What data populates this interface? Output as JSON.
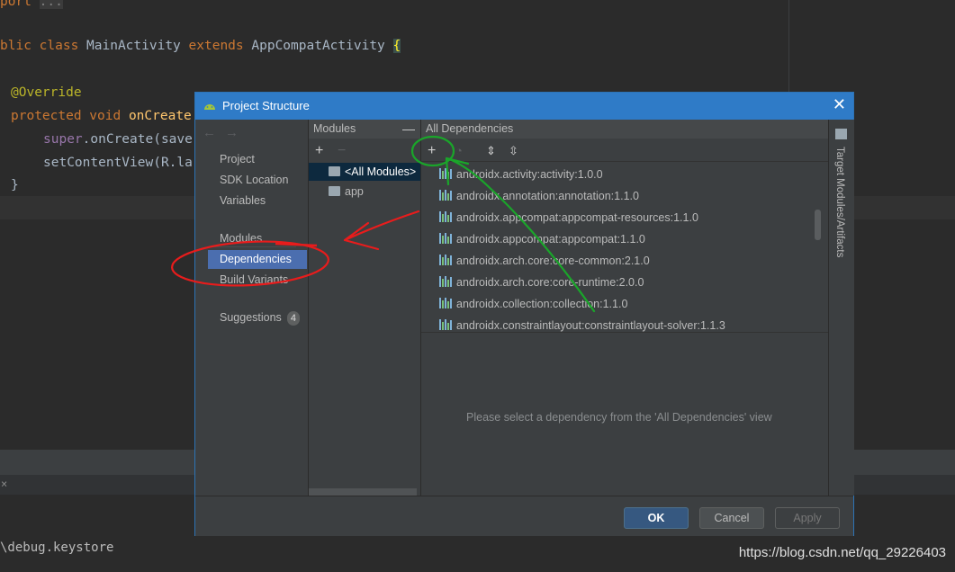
{
  "editor": {
    "lines": [
      {
        "text_a": "port ",
        "text_b": "..."
      },
      {
        "kw": "blic class ",
        "name": "MainActivity ",
        "kw2": "extends ",
        "name2": "AppCompatActivity ",
        "brace": "{"
      },
      {
        "ann": "@Override"
      },
      {
        "kw": "protected void ",
        "fn": "onCreate"
      },
      {
        "purple": "super",
        "rest": ".onCreate(save"
      },
      {
        "rest": "setContentView(R.la"
      },
      {
        "rest": "}"
      }
    ],
    "console_text": "\\debug.keystore",
    "watermark": "https://blog.csdn.net/qq_29226403"
  },
  "dialog": {
    "title": "Project Structure",
    "nav": {
      "items": [
        "Project",
        "SDK Location",
        "Variables",
        "Modules",
        "Dependencies",
        "Build Variants",
        "Suggestions"
      ],
      "suggestions_count": "4",
      "selected": "Dependencies"
    },
    "modules": {
      "header": "Modules",
      "items": [
        "<All Modules>",
        "app"
      ]
    },
    "deps": {
      "header": "All Dependencies",
      "items": [
        "androidx.activity:activity:1.0.0",
        "androidx.annotation:annotation:1.1.0",
        "androidx.appcompat:appcompat-resources:1.1.0",
        "androidx.appcompat:appcompat:1.1.0",
        "androidx.arch.core:core-common:2.1.0",
        "androidx.arch.core:core-runtime:2.0.0",
        "androidx.collection:collection:1.1.0",
        "androidx.constraintlayout:constraintlayout-solver:1.1.3"
      ],
      "placeholder": "Please select a dependency from the 'All Dependencies' view"
    },
    "side_tab": "Target Modules/Artifacts",
    "buttons": {
      "ok": "OK",
      "cancel": "Cancel",
      "apply": "Apply"
    }
  },
  "icons": {
    "close": "close-icon",
    "back": "back-arrow-icon",
    "forward": "forward-arrow-icon",
    "add": "plus-icon",
    "remove": "minus-icon",
    "expand": "expand-all-icon",
    "collapse": "collapse-all-icon",
    "android": "android-icon",
    "folder": "folder-icon",
    "library": "library-icon"
  },
  "colors": {
    "accent": "#2f7bc7",
    "selection": "#4b6eaf",
    "annotation_red": "#e81c1c",
    "annotation_green": "#1aa52a"
  }
}
